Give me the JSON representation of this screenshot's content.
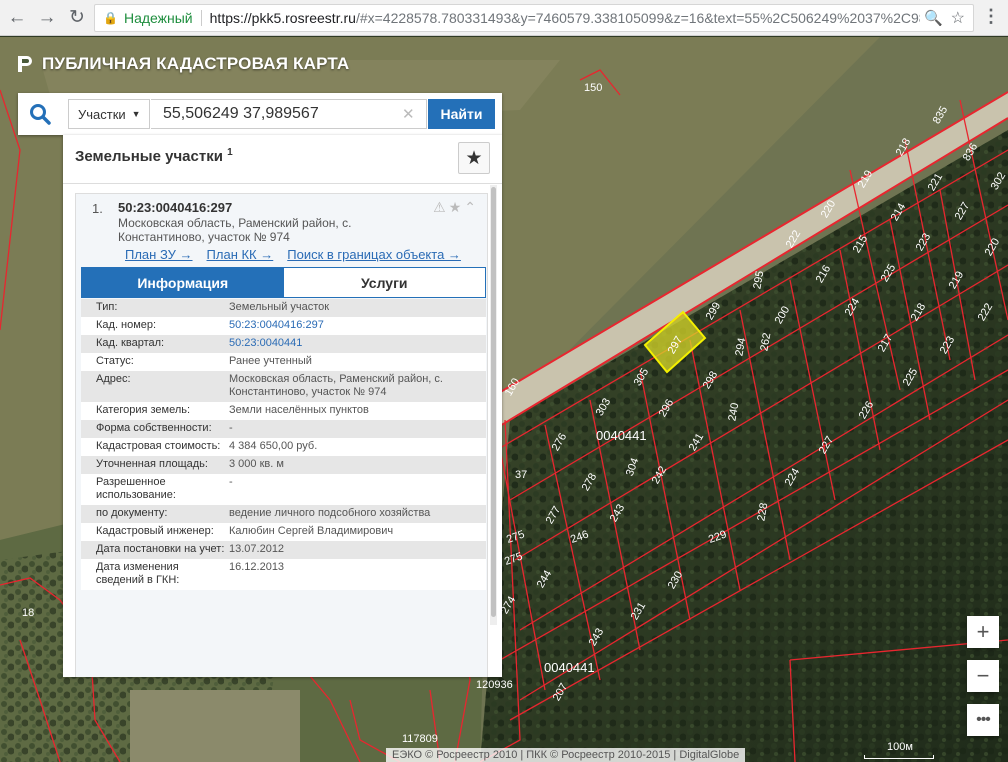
{
  "browser": {
    "back_icon": "←",
    "forward_icon": "→",
    "reload_icon": "↻",
    "secure_label": "Надежный",
    "url_host": "https://pkk5.rosreestr.ru",
    "url_rest": "/#x=4228578.780331493&y=7460579.338105099&z=16&text=55%2C506249%2037%2C989",
    "zoom_icon": "🔍",
    "bookmark_icon": "☆",
    "menu_icon": "⋮"
  },
  "app": {
    "title": "ПУБЛИЧНАЯ КАДАСТРОВАЯ КАРТА"
  },
  "search": {
    "type_label": "Участки",
    "query": "55,506249 37,989567",
    "clear_icon": "✕",
    "find_label": "Найти"
  },
  "panel": {
    "title": "Земельные участки",
    "count": "1",
    "fav_icon": "★"
  },
  "result": {
    "num": "1.",
    "cad_number": "50:23:0040416:297",
    "address": "Московская область, Раменский район, с. Константиново, участок № 974",
    "icons": "⚠★⌃",
    "links": [
      "План ЗУ →",
      "План КК →",
      "Поиск в границах объекта →"
    ],
    "tabs": [
      "Информация",
      "Услуги"
    ],
    "rows": [
      {
        "label": "Тип:",
        "value": "Земельный участок"
      },
      {
        "label": "Кад. номер:",
        "value": "50:23:0040416:297"
      },
      {
        "label": "Кад. квартал:",
        "value": "50:23:0040441"
      },
      {
        "label": "Статус:",
        "value": "Ранее учтенный"
      },
      {
        "label": "Адрес:",
        "value": "Московская область, Раменский район, с. Константиново, участок № 974"
      },
      {
        "label": "Категория земель:",
        "value": "Земли населённых пунктов"
      },
      {
        "label": "Форма собственности:",
        "value": "-"
      },
      {
        "label": "Кадастровая стоимость:",
        "value": "4 384 650,00 руб."
      },
      {
        "label": "Уточненная площадь:",
        "value": "3 000 кв. м"
      },
      {
        "label": "Разрешенное использование:",
        "value": "-"
      },
      {
        "label": "по документу:",
        "value": "ведение личного подсобного хозяйства"
      },
      {
        "label": "Кадастровый инженер:",
        "value": "Калюбин Сергей Владимирович"
      },
      {
        "label": "Дата постановки на учет:",
        "value": "13.07.2012"
      },
      {
        "label": "Дата изменения сведений в ГКН:",
        "value": "16.12.2013"
      }
    ]
  },
  "map": {
    "parcel_labels": [
      "150",
      "835",
      "218",
      "836",
      "219",
      "302",
      "220",
      "221",
      "214",
      "227",
      "222",
      "215",
      "223",
      "220",
      "295",
      "216",
      "225",
      "219",
      "299",
      "200",
      "224",
      "218",
      "222",
      "297",
      "294",
      "262",
      "217",
      "223",
      "305",
      "298",
      "225",
      "160",
      "303",
      "296",
      "240",
      "226",
      "276",
      "241",
      "0040441",
      "37",
      "304",
      "242",
      "227",
      "278",
      "224",
      "277",
      "243",
      "228",
      "246",
      "275",
      "229",
      "275",
      "244",
      "230",
      "231",
      "274",
      "243",
      "0040441",
      "207",
      "120936",
      "117809",
      "18"
    ],
    "colors": {
      "boundary": "#e8262f",
      "selected_fill": "#d8d82a"
    }
  },
  "controls": {
    "zoom_in": "+",
    "zoom_out": "−",
    "menu": "•••",
    "attribution": "ЕЭКО © Росреестр 2010 | ПКК © Росреестр 2010-2015 | DigitalGlobe",
    "scale": "100м"
  }
}
